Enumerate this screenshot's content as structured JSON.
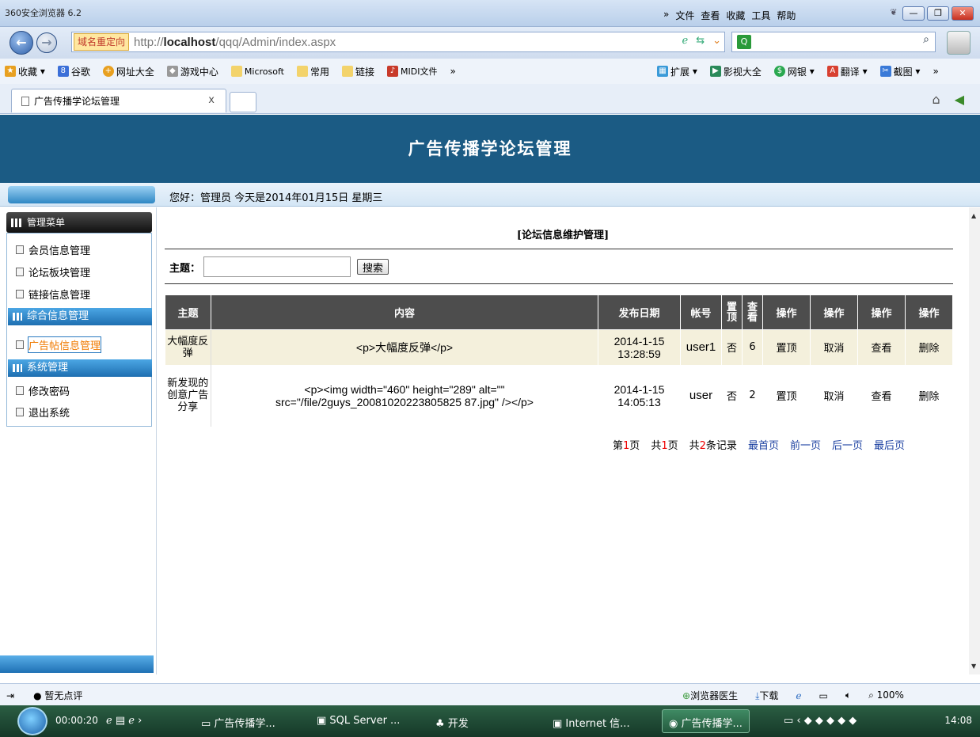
{
  "browser": {
    "app_title": "360安全浏览器 6.2",
    "menu": [
      "»",
      "文件",
      "查看",
      "收藏",
      "工具",
      "帮助"
    ],
    "redirect_label": "域名重定向",
    "url_prefix": "http://",
    "url_host": "localhost",
    "url_path": "/qqq/Admin/index.aspx",
    "favorites": [
      "收藏",
      "谷歌",
      "网址大全",
      "游戏中心",
      "Microsoft",
      "常用",
      "链接",
      "MIDI文件",
      "»"
    ],
    "favorites_right": [
      "扩展",
      "影视大全",
      "网银",
      "翻译",
      "截图",
      "»"
    ],
    "tab_title": "广告传播学论坛管理",
    "tab_close": "x"
  },
  "page": {
    "banner_title": "广告传播学论坛管理",
    "greeting": "您好：管理员  今天是2014年01月15日  星期三",
    "sidebar": {
      "menu_title": "管理菜单",
      "items_group1": [
        "会员信息管理",
        "论坛板块管理",
        "链接信息管理"
      ],
      "section_comprehensive": "综合信息管理",
      "item_post_mgmt": "广告帖信息管理",
      "section_system": "系统管理",
      "items_group2": [
        "修改密码",
        "退出系统"
      ]
    },
    "main_title": "[论坛信息维护管理]",
    "search": {
      "label": "主题：",
      "placeholder": "",
      "button": "搜索"
    },
    "table": {
      "headers": [
        "主题",
        "内容",
        "发布日期",
        "帐号",
        "置顶",
        "查看",
        "操作",
        "操作",
        "操作",
        "操作"
      ],
      "rows": [
        {
          "topic": "大幅度反弹",
          "content": "<p>大幅度反弹</p>",
          "date": "2014-1-15 13:28:59",
          "account": "user1",
          "pinned": "否",
          "views": "6",
          "act1": "置顶",
          "act2": "取消",
          "act3": "查看",
          "act4": "删除"
        },
        {
          "topic": "新发现的创意广告分享",
          "content": "<p><img width=\"460\" height=\"289\" alt=\"\" src=\"/file/2guys_20081020223805825 87.jpg\" /></p>",
          "date": "2014-1-15 14:05:13",
          "account": "user",
          "pinned": "否",
          "views": "2",
          "act1": "置顶",
          "act2": "取消",
          "act3": "查看",
          "act4": "删除"
        }
      ]
    },
    "pager": {
      "page_prefix": "第",
      "page_num": "1",
      "page_suffix": "页",
      "total_prefix": "共",
      "total_pages": "1",
      "total_pages_suffix": "页",
      "records_prefix": "共",
      "records": "2",
      "records_suffix": "条记录",
      "first": "最首页",
      "prev": "前一页",
      "next": "后一页",
      "last": "最后页"
    }
  },
  "status": {
    "rating": "暂无点评",
    "doctor": "浏览器医生",
    "download": "下载",
    "zoom": "100%"
  },
  "taskbar": {
    "timer": "00:00:20",
    "items": [
      "广告传播学...",
      "SQL Server ...",
      "开发",
      "Internet 信...",
      "广告传播学..."
    ],
    "clock": "14:08"
  }
}
